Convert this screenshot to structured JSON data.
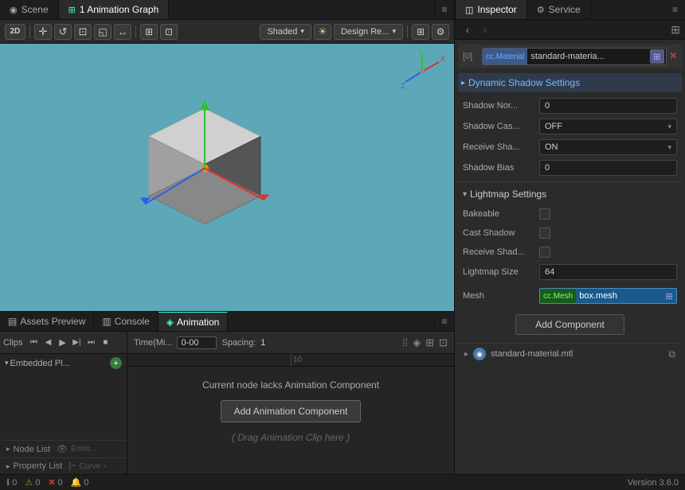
{
  "tabs": {
    "left": [
      {
        "id": "scene",
        "label": "Scene",
        "icon": "◉",
        "active": false
      },
      {
        "id": "animation-graph",
        "label": "1 Animation Graph",
        "icon": "⊞",
        "active": true
      }
    ],
    "right": [
      {
        "id": "inspector",
        "label": "Inspector",
        "icon": "◫",
        "active": true
      },
      {
        "id": "service",
        "label": "Service",
        "icon": "⚙",
        "active": false
      }
    ],
    "bottom": [
      {
        "id": "assets-preview",
        "label": "Assets Preview",
        "icon": "▤",
        "active": false
      },
      {
        "id": "console",
        "label": "Console",
        "icon": "▥",
        "active": false
      },
      {
        "id": "animation",
        "label": "Animation",
        "icon": "◈",
        "active": true
      }
    ]
  },
  "toolbar": {
    "mode_label": "2D/3D",
    "shaded_label": "Shaded",
    "design_label": "Design Re...",
    "buttons": [
      "↺",
      "⟳",
      "⊞",
      "⊡",
      "◱",
      "↔",
      "⊡"
    ]
  },
  "viewport": {
    "bg_color": "#5ca8b8"
  },
  "animation_panel": {
    "toolbar": {
      "time_label": "Time(Mi...",
      "range": "0-00",
      "spacing_label": "Spacing:",
      "spacing_value": "1"
    },
    "sidebar": {
      "embedded_label": "Embedded Pl...",
      "node_list": "Node List",
      "prop_list": "Property List",
      "curve_label": "Curve"
    },
    "message": "Current node lacks Animation Component",
    "add_button": "Add Animation Component",
    "drag_hint": "( Drag Animation Clip here )"
  },
  "inspector": {
    "material": {
      "index": "[0]",
      "tag": "cc.Material",
      "value": "standard-materia...",
      "tag_color": "#3a5a8a",
      "tag_text_color": "#7af"
    },
    "dynamic_shadow": {
      "label": "Dynamic Shadow Settings",
      "shadow_nor_label": "Shadow Nor...",
      "shadow_nor_value": "0",
      "shadow_cas_label": "Shadow Cas...",
      "shadow_cas_value": "OFF",
      "receive_sha1_label": "Receive Sha...",
      "receive_sha1_value": "ON",
      "shadow_bias_label": "Shadow Bias",
      "shadow_bias_value": "0"
    },
    "lightmap": {
      "label": "Lightmap Settings",
      "bakeable_label": "Bakeable",
      "cast_shadow_label": "Cast Shadow",
      "receive_sha2_label": "Receive Shad...",
      "lightmap_size_label": "Lightmap Size",
      "lightmap_size_value": "64"
    },
    "mesh": {
      "label": "Mesh",
      "tag": "cc.Mesh",
      "value": "box.mesh",
      "tag_color": "#1a5a1a",
      "tag_text_color": "#7f7"
    },
    "add_component": "Add Component",
    "material_file": {
      "name": "standard-material.mtl"
    }
  },
  "status_bar": {
    "info_count": "0",
    "warn_count": "0",
    "error_count": "0",
    "notif_count": "0",
    "version": "Version 3.6.0"
  },
  "icons": {
    "check": "✓",
    "arrow_left": "‹",
    "arrow_right": "›",
    "arrow_down": "▾",
    "arrow_right_sm": "▸",
    "arrow_left_sm": "◂",
    "menu": "≡",
    "pin": "⊞",
    "close": "✕",
    "copy": "⧉",
    "add": "+",
    "info": "ℹ",
    "warn": "⚠",
    "error": "✖",
    "bell": "🔔",
    "lock": "🔒"
  }
}
